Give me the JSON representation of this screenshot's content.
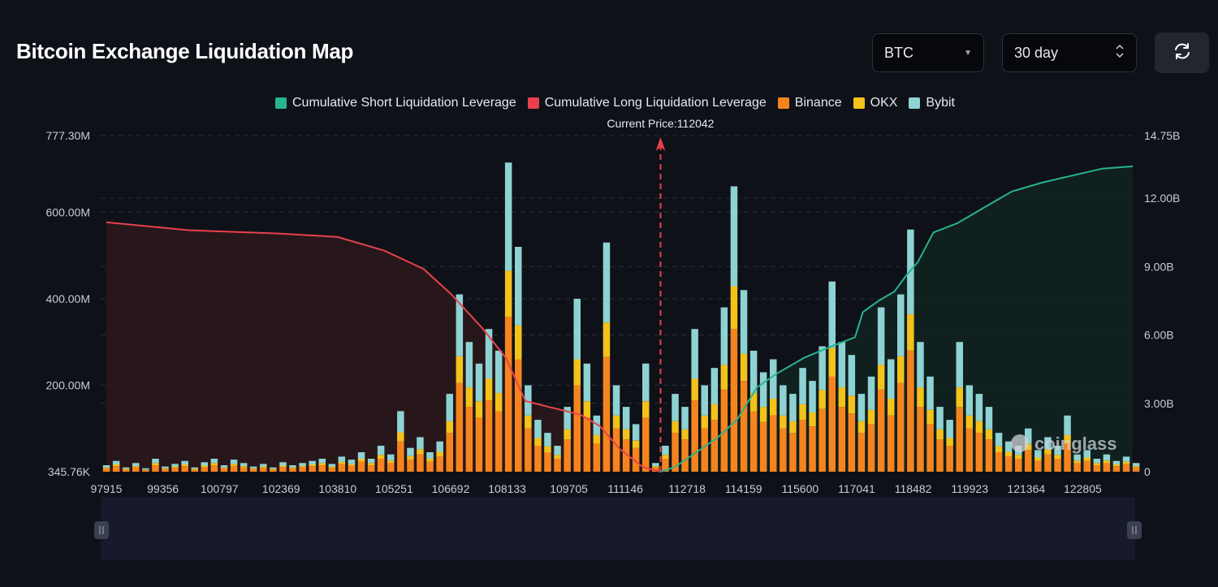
{
  "header": {
    "title": "Bitcoin Exchange Liquidation Map",
    "coin_select": "BTC",
    "range_select": "30 day",
    "refresh_icon": "refresh-icon"
  },
  "watermark": "coinglass",
  "colors": {
    "short": "#27b38e",
    "long": "#e8414d",
    "binance": "#f5841f",
    "okx": "#f3c21b",
    "bybit": "#8ed2d3",
    "background": "#0e1118"
  },
  "chart_data": {
    "type": "bar",
    "current_price_label": "Current Price:112042",
    "current_price": 112042,
    "legend": [
      "Cumulative Short Liquidation Leverage",
      "Cumulative Long Liquidation Leverage",
      "Binance",
      "OKX",
      "Bybit"
    ],
    "legend_placement": "top",
    "grid": true,
    "x_tick_labels": [
      "97915",
      "99356",
      "100797",
      "102369",
      "103810",
      "105251",
      "106692",
      "108133",
      "109705",
      "111146",
      "112718",
      "114159",
      "115600",
      "117041",
      "118482",
      "119923",
      "121364",
      "122805"
    ],
    "y_left_tick_labels": [
      "345.76K",
      "200.00M",
      "400.00M",
      "600.00M",
      "777.30M"
    ],
    "y_right_tick_labels": [
      "0",
      "3.00B",
      "6.00B",
      "9.00B",
      "12.00B",
      "14.75B"
    ],
    "y_left_range_millions": [
      0,
      777.3
    ],
    "y_right_range_billions": [
      0,
      14.75
    ],
    "x_range": [
      97770,
      124080
    ],
    "bar_price_start": 97915,
    "bar_price_step": 250,
    "series": [
      {
        "name": "Binance",
        "values": [
          8,
          13,
          5,
          10,
          4,
          15,
          6,
          9,
          13,
          5,
          11,
          15,
          8,
          14,
          10,
          6,
          9,
          5,
          11,
          8,
          10,
          13,
          15,
          9,
          18,
          14,
          23,
          15,
          30,
          20,
          70,
          28,
          40,
          23,
          35,
          90,
          205,
          150,
          125,
          165,
          140,
          358,
          260,
          100,
          60,
          45,
          30,
          75,
          200,
          125,
          65,
          265,
          100,
          75,
          55,
          125,
          10,
          30,
          90,
          75,
          165,
          100,
          120,
          190,
          330,
          210,
          140,
          115,
          130,
          100,
          90,
          120,
          105,
          145,
          220,
          150,
          135,
          90,
          110,
          190,
          130,
          205,
          280,
          150,
          110,
          75,
          60,
          150,
          100,
          90,
          75,
          45,
          35,
          30,
          50,
          25,
          40,
          30,
          65,
          20,
          25,
          15,
          20,
          13,
          18,
          10
        ]
      },
      {
        "name": "OKX",
        "values": [
          2,
          4,
          2,
          3,
          1,
          5,
          2,
          3,
          4,
          2,
          3,
          5,
          2,
          4,
          3,
          2,
          3,
          2,
          3,
          2,
          3,
          4,
          5,
          3,
          5,
          4,
          7,
          5,
          9,
          6,
          21,
          8,
          12,
          7,
          11,
          27,
          62,
          45,
          38,
          50,
          42,
          107,
          78,
          30,
          18,
          14,
          9,
          23,
          60,
          38,
          20,
          80,
          30,
          23,
          17,
          38,
          3,
          9,
          27,
          23,
          50,
          30,
          36,
          57,
          99,
          63,
          42,
          35,
          39,
          30,
          27,
          36,
          32,
          44,
          66,
          45,
          41,
          27,
          33,
          57,
          39,
          62,
          84,
          45,
          33,
          23,
          18,
          45,
          30,
          27,
          23,
          14,
          11,
          9,
          15,
          8,
          12,
          9,
          20,
          6,
          8,
          5,
          6,
          4,
          5,
          3
        ]
      },
      {
        "name": "Bybit",
        "values": [
          5,
          8,
          3,
          7,
          3,
          10,
          4,
          6,
          8,
          3,
          8,
          10,
          5,
          10,
          7,
          4,
          6,
          3,
          8,
          5,
          7,
          8,
          10,
          6,
          12,
          10,
          15,
          10,
          21,
          14,
          49,
          19,
          28,
          15,
          24,
          63,
          143,
          105,
          87,
          115,
          98,
          250,
          182,
          70,
          42,
          31,
          21,
          52,
          140,
          87,
          45,
          185,
          70,
          52,
          38,
          87,
          7,
          21,
          63,
          52,
          115,
          70,
          84,
          133,
          231,
          147,
          98,
          80,
          91,
          70,
          63,
          84,
          73,
          101,
          154,
          105,
          94,
          63,
          77,
          133,
          91,
          143,
          196,
          105,
          77,
          52,
          42,
          105,
          70,
          63,
          52,
          31,
          24,
          21,
          35,
          17,
          28,
          21,
          45,
          14,
          17,
          10,
          14,
          8,
          12,
          7
        ]
      }
    ],
    "cumulative_long_billions": [
      [
        97915,
        10.95
      ],
      [
        100000,
        10.6
      ],
      [
        102369,
        10.45
      ],
      [
        103810,
        10.3
      ],
      [
        105000,
        9.7
      ],
      [
        106000,
        8.9
      ],
      [
        106700,
        7.8
      ],
      [
        107500,
        6.3
      ],
      [
        108100,
        5.0
      ],
      [
        108600,
        3.1
      ],
      [
        110000,
        2.5
      ],
      [
        110500,
        2.0
      ],
      [
        111000,
        1.0
      ],
      [
        111600,
        0.2
      ],
      [
        112042,
        0
      ]
    ],
    "cumulative_short_billions": [
      [
        112042,
        0
      ],
      [
        112400,
        0.2
      ],
      [
        113500,
        1.5
      ],
      [
        114000,
        2.3
      ],
      [
        114500,
        3.7
      ],
      [
        115000,
        4.3
      ],
      [
        115700,
        5.0
      ],
      [
        116400,
        5.5
      ],
      [
        117000,
        5.9
      ],
      [
        117200,
        7.0
      ],
      [
        117600,
        7.5
      ],
      [
        118000,
        7.9
      ],
      [
        118300,
        8.6
      ],
      [
        118600,
        9.2
      ],
      [
        119000,
        10.5
      ],
      [
        119600,
        10.9
      ],
      [
        120300,
        11.6
      ],
      [
        121000,
        12.3
      ],
      [
        121800,
        12.7
      ],
      [
        122800,
        13.1
      ],
      [
        123300,
        13.3
      ],
      [
        124080,
        13.4
      ]
    ]
  }
}
